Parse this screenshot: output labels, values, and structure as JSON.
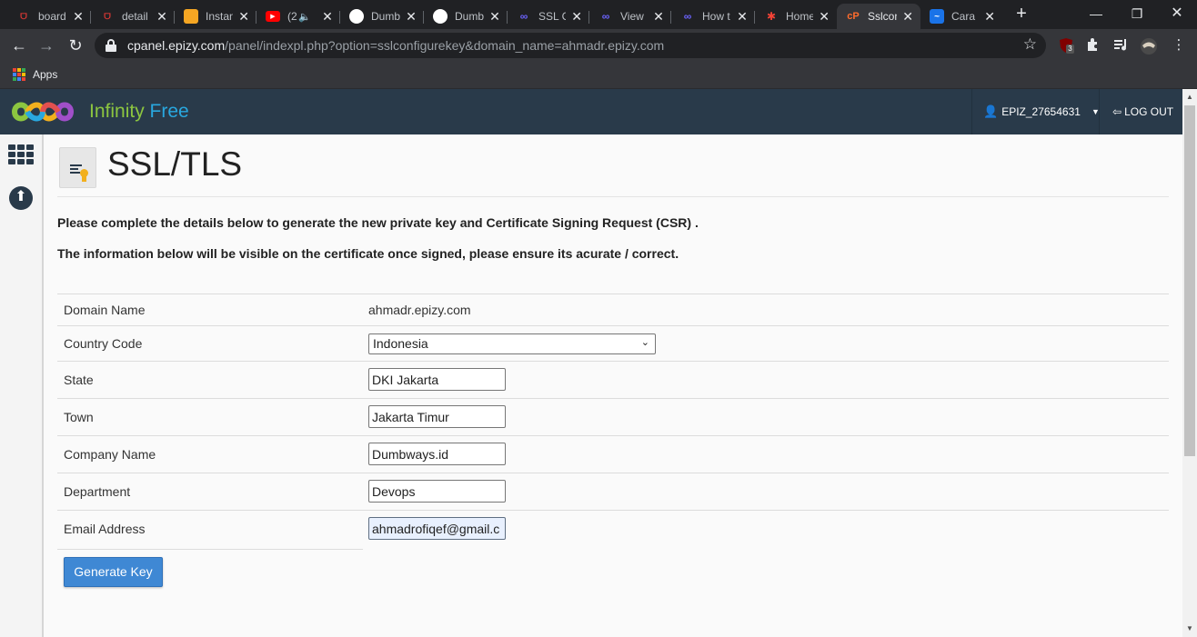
{
  "browser": {
    "tabs": [
      {
        "title": "board",
        "favicon_color": "#e53935",
        "favicon_glyph": "DW"
      },
      {
        "title": "detail",
        "favicon_color": "#e53935",
        "favicon_glyph": "DW"
      },
      {
        "title": "Instan",
        "favicon_color": "#f5a623",
        "favicon_glyph": "box"
      },
      {
        "title": "(2",
        "favicon_color": "#ff0000",
        "favicon_glyph": "yt"
      },
      {
        "title": "Dumb",
        "favicon_color": "#ffffff",
        "favicon_glyph": "gh"
      },
      {
        "title": "Dumb",
        "favicon_color": "#ffffff",
        "favicon_glyph": "gh"
      },
      {
        "title": "SSL C",
        "favicon_color": "#6c63ff",
        "favicon_glyph": "inf"
      },
      {
        "title": "View",
        "favicon_color": "#6c63ff",
        "favicon_glyph": "inf"
      },
      {
        "title": "How t",
        "favicon_color": "#6c63ff",
        "favicon_glyph": "inf"
      },
      {
        "title": "Home",
        "favicon_color": "#f44336",
        "favicon_glyph": "joomla"
      },
      {
        "title": "Sslcon",
        "favicon_color": "#ff6c2c",
        "favicon_glyph": "cp",
        "active": true
      },
      {
        "title": "Cara I",
        "favicon_color": "#1a73e8",
        "favicon_glyph": "blog"
      }
    ],
    "close_glyph": "✕",
    "new_tab_glyph": "+",
    "window_controls": {
      "minimize": "—",
      "restore": "❐",
      "close": "✕"
    },
    "url_host": "cpanel.epizy.com",
    "url_path": "/panel/indexpl.php?option=sslconfigurekey&domain_name=ahmadr.epizy.com",
    "ublock_badge": "3",
    "bookmarks": {
      "apps_label": "Apps"
    }
  },
  "header": {
    "brand_part1": "Infinity",
    "brand_part2": "Free",
    "username": "EPIZ_27654631",
    "logout_label": "LOG OUT"
  },
  "page": {
    "title": "SSL/TLS",
    "intro_line1": "Please complete the details below to generate the new private key and Certificate Signing Request (CSR) .",
    "intro_line2": "The information below will be visible on the certificate once signed, please ensure its acurate / correct."
  },
  "form": {
    "domain_name_label": "Domain Name",
    "domain_name_value": "ahmadr.epizy.com",
    "country_code_label": "Country Code",
    "country_code_value": "Indonesia",
    "state_label": "State",
    "state_value": "DKI Jakarta",
    "town_label": "Town",
    "town_value": "Jakarta Timur",
    "company_label": "Company Name",
    "company_value": "Dumbways.id",
    "department_label": "Department",
    "department_value": "Devops",
    "email_label": "Email Address",
    "email_value": "ahmadrofiqef@gmail.c",
    "submit_label": "Generate Key"
  },
  "colors": {
    "header_bg": "#293a4a",
    "brand_green": "#8cc540",
    "brand_blue": "#29a8e0",
    "button_blue": "#3f88d4"
  }
}
